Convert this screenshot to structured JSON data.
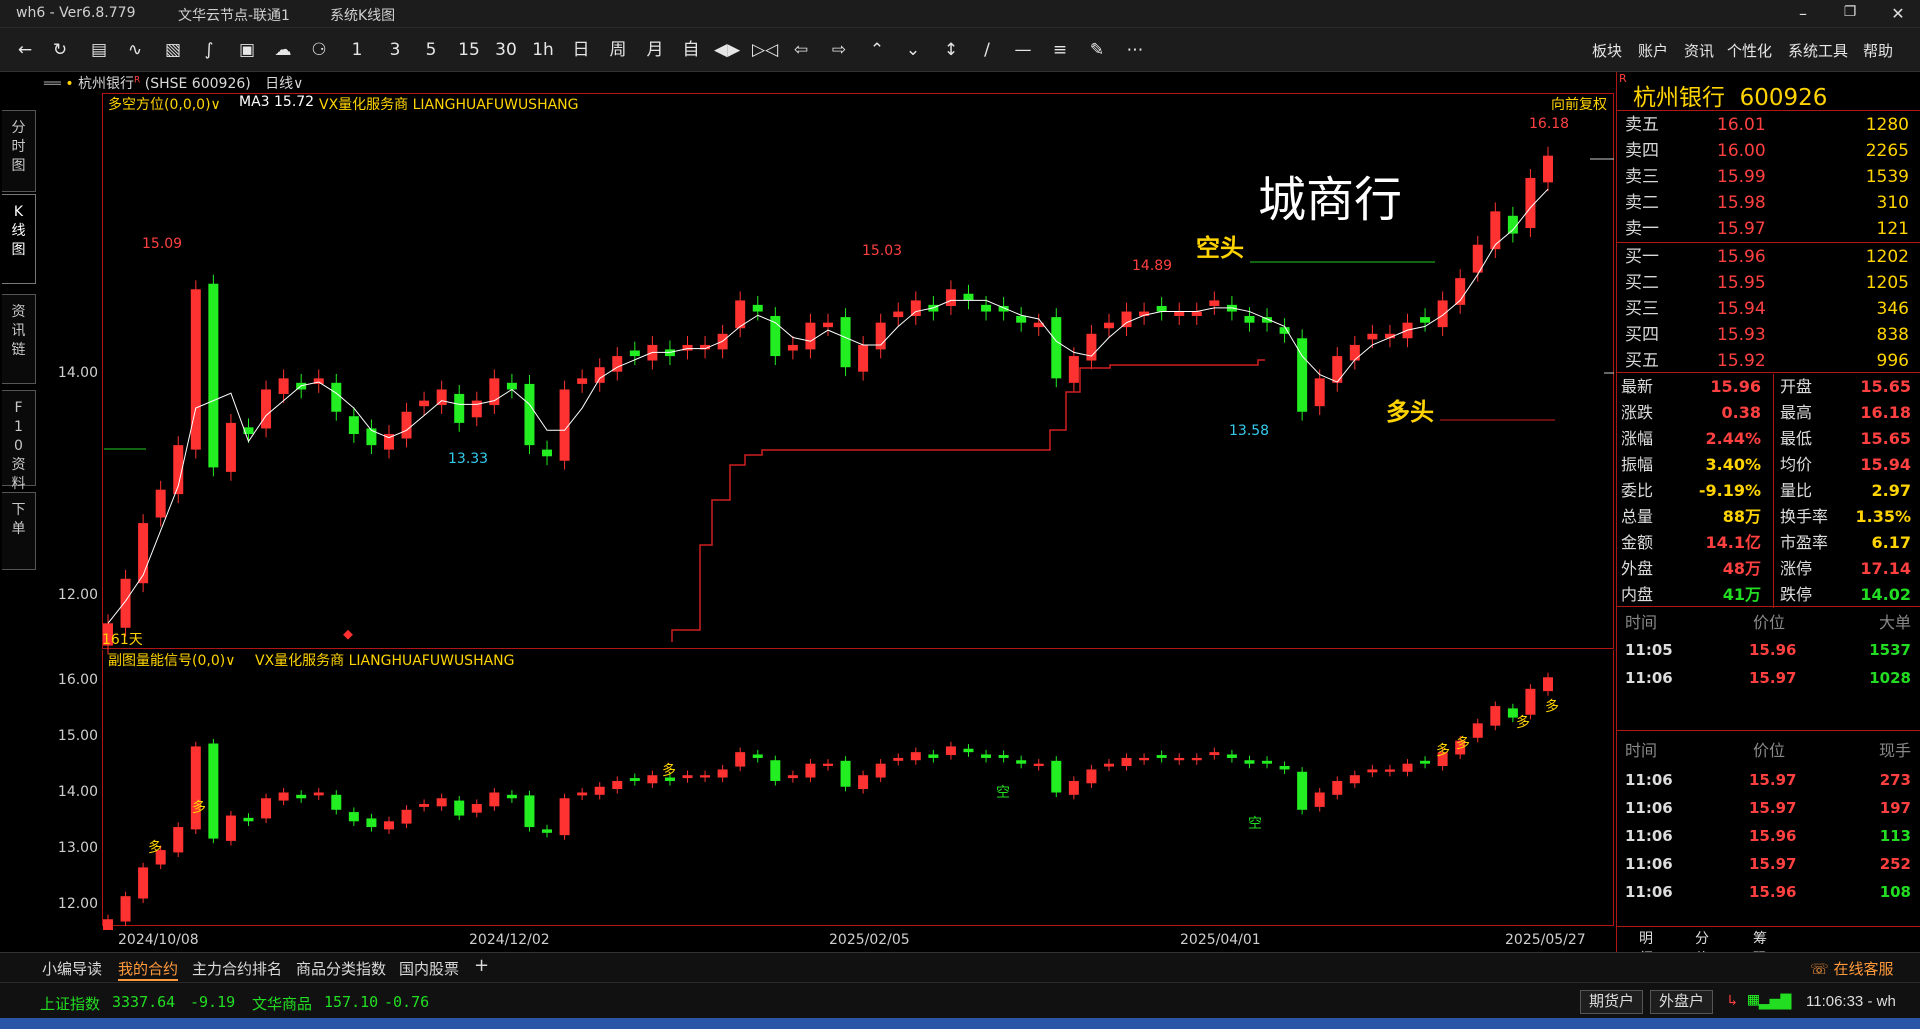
{
  "titlebar": {
    "app": "wh6  -  Ver6.8.779",
    "node": "文华云节点-联通1",
    "view": "系统K线图"
  },
  "toolbar": {
    "icons": [
      "back-icon",
      "refresh-icon",
      "list-icon",
      "line-chart-icon",
      "kline-icon",
      "indicator-icon",
      "screen-icon",
      "cloud-icon",
      "bell-icon"
    ],
    "periods": [
      "1",
      "3",
      "5",
      "15",
      "30",
      "1h",
      "日",
      "周",
      "月",
      "自"
    ],
    "right_menu": [
      "板块",
      "账户",
      "资讯",
      "个性化",
      "系统工具",
      "帮助"
    ]
  },
  "lefttabs": [
    "分时图",
    "K线图",
    "资讯链",
    "F10资料",
    "下单"
  ],
  "header": {
    "symbol": "杭州银行",
    "superscript": "R",
    "code": "(SHSE  600926)",
    "period": "日线",
    "indicator": "多空方位(0,0,0)",
    "ma": "MA3  15.72",
    "vendor": "VX量化服务商  LIANGHUAFUWUSHANG",
    "adjust": "向前复权",
    "sub_indicator": "副图量能信号(0,0)",
    "sub_vendor": "VX量化服务商  LIANGHUAFUWUSHANG",
    "days": "161天"
  },
  "annotations": {
    "title_big": "城商行",
    "short": "空头",
    "long": "多头",
    "mark_15_09": "15.09",
    "mark_15_03": "15.03",
    "mark_14_89": "14.89",
    "mark_16_18": "16.18",
    "mark_13_33": "13.33",
    "mark_13_58": "13.58",
    "sig_duo": "多",
    "sig_kong": "空"
  },
  "chart_data": [
    {
      "type": "candlestick",
      "title": "杭州银行 日线",
      "ylim": [
        11.75,
        16.6
      ],
      "yticks": [
        "14.00",
        "12.00"
      ],
      "xlabels": [
        "2024/10/08",
        "2024/12/02",
        "2025/02/05",
        "2025/04/01",
        "2025/05/27"
      ],
      "close": [
        11.9,
        12.3,
        12.8,
        13.1,
        13.5,
        14.9,
        13.3,
        13.7,
        13.6,
        14.0,
        14.1,
        14.0,
        14.1,
        13.8,
        13.6,
        13.5,
        13.6,
        13.8,
        13.9,
        14.0,
        13.7,
        13.9,
        14.1,
        14.0,
        13.5,
        13.4,
        14.0,
        14.1,
        14.2,
        14.3,
        14.3,
        14.4,
        14.3,
        14.4,
        14.4,
        14.5,
        14.8,
        14.7,
        14.3,
        14.4,
        14.6,
        14.6,
        14.2,
        14.4,
        14.6,
        14.7,
        14.8,
        14.7,
        14.9,
        14.8,
        14.7,
        14.7,
        14.6,
        14.6,
        14.1,
        14.3,
        14.5,
        14.6,
        14.7,
        14.7,
        14.7,
        14.7,
        14.7,
        14.8,
        14.7,
        14.6,
        14.6,
        14.5,
        13.8,
        14.1,
        14.3,
        14.4,
        14.5,
        14.5,
        14.6,
        14.6,
        14.8,
        15.0,
        15.3,
        15.6,
        15.4,
        15.9,
        16.1
      ],
      "highlights": {
        "high": 16.18,
        "low": 13.33
      }
    },
    {
      "type": "candlestick",
      "title": "副图量能信号",
      "ylim": [
        11.8,
        16.4
      ],
      "yticks": [
        "16.00",
        "15.00",
        "14.00",
        "13.00",
        "12.00"
      ]
    }
  ],
  "quote": {
    "name": "杭州银行",
    "code": "600926",
    "sells": [
      {
        "n": "卖五",
        "p": "16.01",
        "v": "1280"
      },
      {
        "n": "卖四",
        "p": "16.00",
        "v": "2265"
      },
      {
        "n": "卖三",
        "p": "15.99",
        "v": "1539"
      },
      {
        "n": "卖二",
        "p": "15.98",
        "v": "310"
      },
      {
        "n": "卖一",
        "p": "15.97",
        "v": "121"
      }
    ],
    "buys": [
      {
        "n": "买一",
        "p": "15.96",
        "v": "1202"
      },
      {
        "n": "买二",
        "p": "15.95",
        "v": "1205"
      },
      {
        "n": "买三",
        "p": "15.94",
        "v": "346"
      },
      {
        "n": "买四",
        "p": "15.93",
        "v": "838"
      },
      {
        "n": "买五",
        "p": "15.92",
        "v": "996"
      }
    ],
    "stats": [
      {
        "a": "最新",
        "av": "15.96",
        "ac": "#ff4040",
        "b": "开盘",
        "bv": "15.65",
        "bc": "#ff4040"
      },
      {
        "a": "涨跌",
        "av": "0.38",
        "ac": "#ff4040",
        "b": "最高",
        "bv": "16.18",
        "bc": "#ff4040"
      },
      {
        "a": "涨幅",
        "av": "2.44%",
        "ac": "#ff4040",
        "b": "最低",
        "bv": "15.65",
        "bc": "#ff4040"
      },
      {
        "a": "振幅",
        "av": "3.40%",
        "ac": "#ffd400",
        "b": "均价",
        "bv": "15.94",
        "bc": "#ff4040"
      },
      {
        "a": "委比",
        "av": "-9.19%",
        "ac": "#ffd400",
        "b": "量比",
        "bv": "2.97",
        "bc": "#ffd400"
      },
      {
        "a": "总量",
        "av": "88万",
        "ac": "#ffd400",
        "b": "换手率",
        "bv": "1.35%",
        "bc": "#ffd400"
      },
      {
        "a": "金额",
        "av": "14.1亿",
        "ac": "#ff4040",
        "b": "市盈率",
        "bv": "6.17",
        "bc": "#ffd400"
      },
      {
        "a": "外盘",
        "av": "48万",
        "ac": "#ff4040",
        "b": "涨停",
        "bv": "17.14",
        "bc": "#ff4040"
      },
      {
        "a": "内盘",
        "av": "41万",
        "ac": "#22dd22",
        "b": "跌停",
        "bv": "14.02",
        "bc": "#22dd22"
      }
    ],
    "bigorders_header": [
      "时间",
      "价位",
      "大单"
    ],
    "bigorders": [
      {
        "t": "11:05",
        "p": "15.96",
        "v": "1537",
        "vc": "#22dd22"
      },
      {
        "t": "11:06",
        "p": "15.97",
        "v": "1028",
        "vc": "#22dd22"
      }
    ],
    "ticks_header": [
      "时间",
      "价位",
      "现手"
    ],
    "ticks": [
      {
        "t": "11:06",
        "p": "15.97",
        "v": "273",
        "vc": "#ff4040"
      },
      {
        "t": "11:06",
        "p": "15.97",
        "v": "197",
        "vc": "#ff4040"
      },
      {
        "t": "11:06",
        "p": "15.96",
        "v": "113",
        "vc": "#22dd22"
      },
      {
        "t": "11:06",
        "p": "15.97",
        "v": "252",
        "vc": "#ff4040"
      },
      {
        "t": "11:06",
        "p": "15.96",
        "v": "108",
        "vc": "#22dd22"
      }
    ],
    "tabs": [
      "明细",
      "分价",
      "筹码"
    ]
  },
  "bottomtabs": [
    "小编导读",
    "我的合约",
    "主力合约排名",
    "商品分类指数",
    "国内股票",
    "+"
  ],
  "support": "在线客服",
  "status": {
    "idx1_name": "上证指数",
    "idx1_val": "3337.64",
    "idx1_chg": "-9.19",
    "idx2_name": "文华商品",
    "idx2_val": "157.10",
    "idx2_chg": "-0.76",
    "btn1": "期货户",
    "btn2": "外盘户",
    "clock": "11:06:33 - wh"
  },
  "colors": {
    "up": "#ff3232",
    "down": "#22ee22",
    "frame": "#b01616",
    "yellow": "#ffd400",
    "cyan": "#33ccee"
  }
}
